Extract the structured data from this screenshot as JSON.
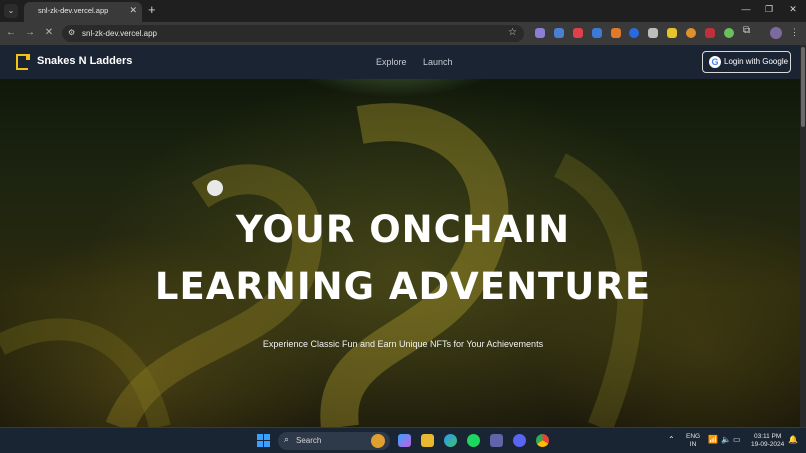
{
  "browser": {
    "tab_title": "snl-zk-dev.vercel.app",
    "url": "snl-zk-dev.vercel.app"
  },
  "site": {
    "brand": "Snakes N Ladders",
    "nav": [
      "Explore",
      "Launch"
    ],
    "login_label": "Login with Google"
  },
  "hero": {
    "title_line1": "YOUR ONCHAIN",
    "title_line2": "LEARNING ADVENTURE",
    "subtitle": "Experience Classic Fun and Earn Unique NFTs for Your Achievements"
  },
  "taskbar": {
    "search_placeholder": "Search",
    "lang_line1": "ENG",
    "lang_line2": "IN",
    "time": "03:11 PM",
    "date": "19-09-2024"
  },
  "colors": {
    "site_nav_bg": "#1b2433",
    "brand_accent": "#f2c21b",
    "chrome_bg": "#3a3a3a"
  }
}
